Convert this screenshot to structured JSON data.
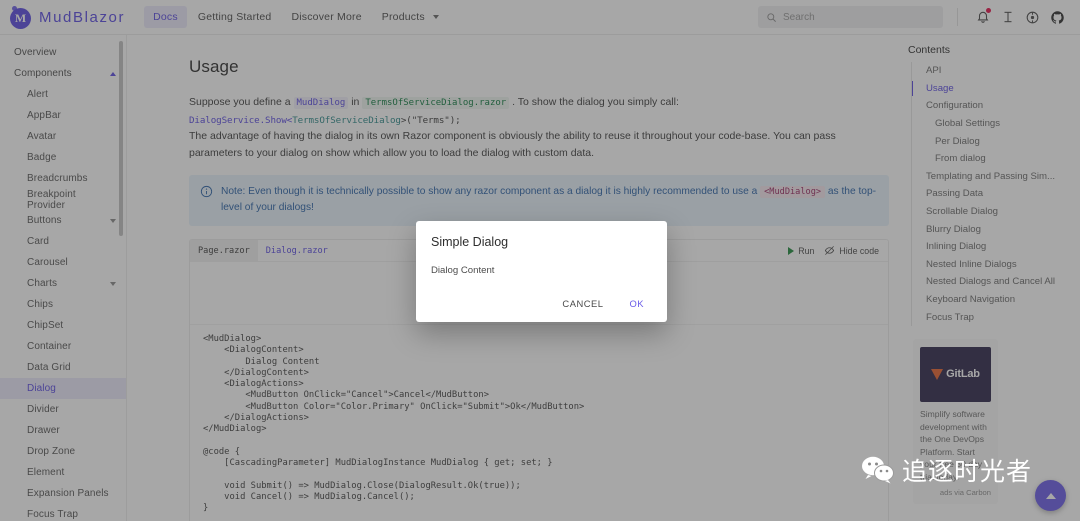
{
  "appbar": {
    "brand": "MudBlazor",
    "logo_icon": "mudblazor-logo-icon",
    "nav": [
      {
        "label": "Docs",
        "active": true
      },
      {
        "label": "Getting Started",
        "active": false
      },
      {
        "label": "Discover More",
        "active": false
      },
      {
        "label": "Products",
        "active": false,
        "has_caret": true
      }
    ],
    "search_placeholder": "Search",
    "search_icon": "search-icon",
    "icons": [
      {
        "name": "bell-icon",
        "badge": true
      },
      {
        "name": "text-format-icon",
        "badge": false
      },
      {
        "name": "theme-toggle-icon",
        "badge": false
      },
      {
        "name": "github-icon",
        "badge": false
      }
    ]
  },
  "sidebar": {
    "items": [
      {
        "label": "Overview",
        "level": 1,
        "active": false
      },
      {
        "label": "Components",
        "level": 1,
        "active": false,
        "chevron": "up"
      },
      {
        "label": "Alert",
        "level": 2,
        "active": false
      },
      {
        "label": "AppBar",
        "level": 2,
        "active": false
      },
      {
        "label": "Avatar",
        "level": 2,
        "active": false
      },
      {
        "label": "Badge",
        "level": 2,
        "active": false
      },
      {
        "label": "Breadcrumbs",
        "level": 2,
        "active": false
      },
      {
        "label": "Breakpoint Provider",
        "level": 2,
        "active": false
      },
      {
        "label": "Buttons",
        "level": 2,
        "active": false,
        "chevron": "down"
      },
      {
        "label": "Card",
        "level": 2,
        "active": false
      },
      {
        "label": "Carousel",
        "level": 2,
        "active": false
      },
      {
        "label": "Charts",
        "level": 2,
        "active": false,
        "chevron": "down"
      },
      {
        "label": "Chips",
        "level": 2,
        "active": false
      },
      {
        "label": "ChipSet",
        "level": 2,
        "active": false
      },
      {
        "label": "Container",
        "level": 2,
        "active": false
      },
      {
        "label": "Data Grid",
        "level": 2,
        "active": false
      },
      {
        "label": "Dialog",
        "level": 2,
        "active": true
      },
      {
        "label": "Divider",
        "level": 2,
        "active": false
      },
      {
        "label": "Drawer",
        "level": 2,
        "active": false
      },
      {
        "label": "Drop Zone",
        "level": 2,
        "active": false
      },
      {
        "label": "Element",
        "level": 2,
        "active": false
      },
      {
        "label": "Expansion Panels",
        "level": 2,
        "active": false
      },
      {
        "label": "Focus Trap",
        "level": 2,
        "active": false
      }
    ]
  },
  "main": {
    "heading": "Usage",
    "intro": {
      "p1_a": "Suppose you define a",
      "code_muddialog": "MudDialog",
      "p1_b": "in",
      "code_razorfile": "TermsOfServiceDialog.razor",
      "p1_c": ". To show the dialog you simply call:",
      "call_line_1": "DialogService.Show<",
      "call_line_2": "TermsOfServiceDialog",
      "call_line_3": ">(\"Terms\");",
      "p2": "The advantage of having the dialog in its own Razor component is obviously the ability to reuse it throughout your code-base. You can pass parameters to your dialog on show which allow you to load the dialog with custom data."
    },
    "note": {
      "icon": "info-circle-icon",
      "text_a": "Note: Even though it is technically possible to show any razor component as a dialog it is highly recommended to use a",
      "chip": "<MudDialog>",
      "text_b": "as the top-level of your dialogs!"
    },
    "demo": {
      "tabs": [
        {
          "label": "Page.razor",
          "active": true
        },
        {
          "label": "Dialog.razor",
          "active": false
        }
      ],
      "run_label": "Run",
      "run_icon": "play-icon",
      "hide_label": "Hide code",
      "hide_icon": "eye-off-icon",
      "code": "<MudDialog>\n    <DialogContent>\n        Dialog Content\n    </DialogContent>\n    <DialogActions>\n        <MudButton OnClick=\"Cancel\">Cancel</MudButton>\n        <MudButton Color=\"Color.Primary\" OnClick=\"Submit\">Ok</MudButton>\n    </DialogActions>\n</MudDialog>\n\n@code {\n    [CascadingParameter] MudDialogInstance MudDialog { get; set; }\n\n    void Submit() => MudDialog.Close(DialogResult.Ok(true));\n    void Cancel() => MudDialog.Cancel();\n}"
    }
  },
  "toc": {
    "title": "Contents",
    "items": [
      {
        "label": "API",
        "sub": false,
        "active": false
      },
      {
        "label": "Usage",
        "sub": false,
        "active": true
      },
      {
        "label": "Configuration",
        "sub": false,
        "active": false
      },
      {
        "label": "Global Settings",
        "sub": true,
        "active": false
      },
      {
        "label": "Per Dialog",
        "sub": true,
        "active": false
      },
      {
        "label": "From dialog",
        "sub": true,
        "active": false
      },
      {
        "label": "Templating and Passing Sim...",
        "sub": false,
        "active": false
      },
      {
        "label": "Passing Data",
        "sub": false,
        "active": false
      },
      {
        "label": "Scrollable Dialog",
        "sub": false,
        "active": false
      },
      {
        "label": "Blurry Dialog",
        "sub": false,
        "active": false
      },
      {
        "label": "Inlining Dialog",
        "sub": false,
        "active": false
      },
      {
        "label": "Nested Inline Dialogs",
        "sub": false,
        "active": false
      },
      {
        "label": "Nested Dialogs and Cancel All",
        "sub": false,
        "active": false
      },
      {
        "label": "Keyboard Navigation",
        "sub": false,
        "active": false
      },
      {
        "label": "Focus Trap",
        "sub": false,
        "active": false
      }
    ],
    "ad": {
      "logo_icon": "gitlab-icon",
      "logo_text": "GitLab",
      "body": "Simplify software development with the One DevOps Platform. Start your free 30 day trial today.",
      "via": "ads via Carbon"
    }
  },
  "dialog": {
    "title": "Simple Dialog",
    "content": "Dialog Content",
    "cancel_label": "CANCEL",
    "ok_label": "OK"
  },
  "fab": {
    "icon": "chevron-up-icon"
  },
  "watermark": {
    "icon": "wechat-icon",
    "text": "追逐时光者"
  },
  "colors": {
    "primary": "#594ae2",
    "accent_light": "#eceafc",
    "info": "#2b63a8",
    "badge": "#e5104a",
    "gitlab_bg": "#2c2549"
  }
}
